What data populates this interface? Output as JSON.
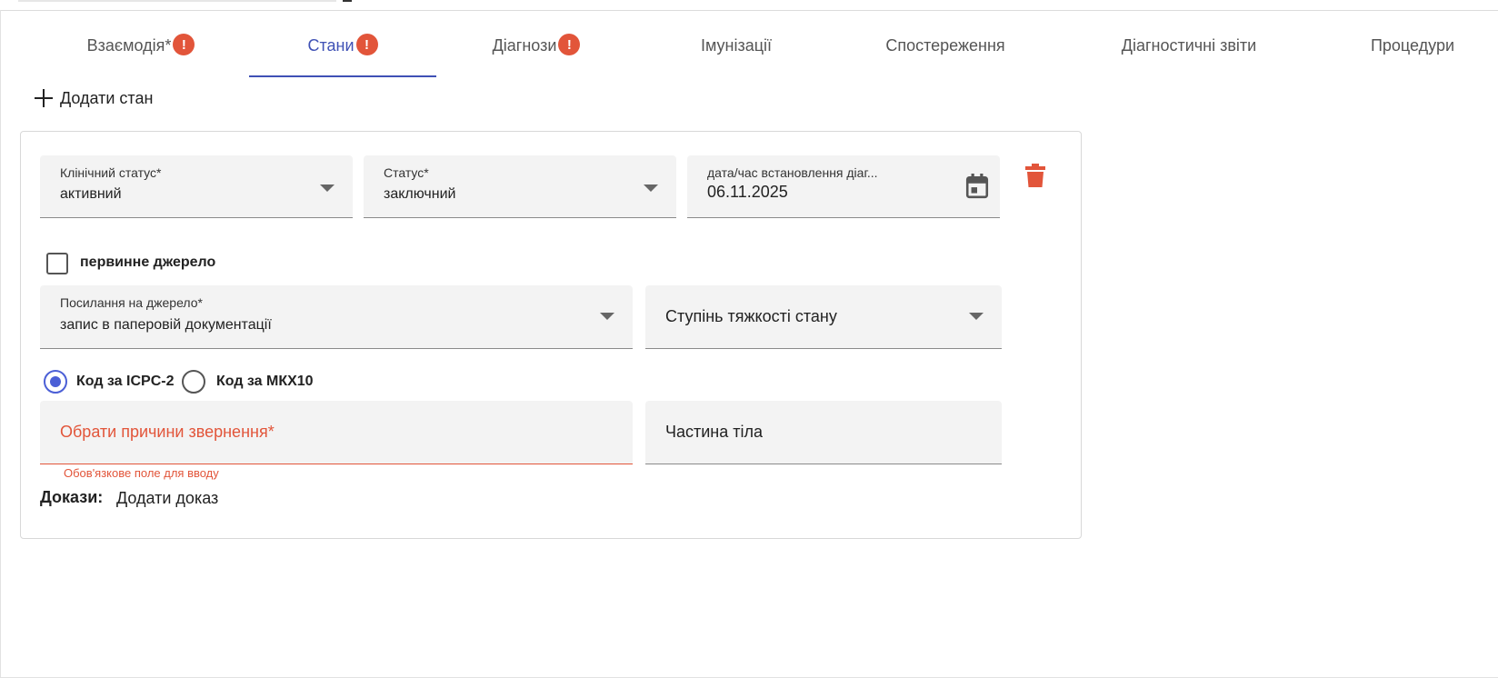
{
  "tabs": [
    {
      "label": "Взаємодія*",
      "error": "!"
    },
    {
      "label": "Стани",
      "error": "!",
      "active": true
    },
    {
      "label": "Діагнози",
      "error": "!"
    },
    {
      "label": "Імунізації"
    },
    {
      "label": "Спостереження"
    },
    {
      "label": "Діагностичні звіти"
    },
    {
      "label": "Процедури"
    }
  ],
  "add_condition_label": "Додати стан",
  "fields": {
    "clinical_status": {
      "label": "Клінічний статус*",
      "value": "активний"
    },
    "status": {
      "label": "Статус*",
      "value": "заключний"
    },
    "diagnosis_datetime": {
      "label": "дата/час встановлення діаг...",
      "value": "06.11.2025"
    },
    "source_reference": {
      "label": "Посилання на джерело*",
      "value": "запис в паперовій документації"
    },
    "severity": {
      "placeholder": "Ступінь тяжкості стану"
    },
    "reasons": {
      "placeholder": "Обрати причини звернення*",
      "error": "Обов'язкове поле для вводу"
    },
    "body_part": {
      "placeholder": "Частина тіла"
    }
  },
  "primary_source": {
    "label": "первинне джерело",
    "checked": false
  },
  "code_system": {
    "options": [
      {
        "label": "Код за ICPC-2",
        "selected": true
      },
      {
        "label": "Код за МКХ10",
        "selected": false
      }
    ]
  },
  "evidence": {
    "label": "Докази:",
    "add_label": "Додати доказ"
  },
  "colors": {
    "accent": "#3f51b5",
    "error": "#e2553a",
    "radio": "#4b5fd6"
  },
  "icons": [
    "plus-icon",
    "calendar-icon",
    "trash-icon",
    "chevron-down-icon",
    "error-icon"
  ]
}
